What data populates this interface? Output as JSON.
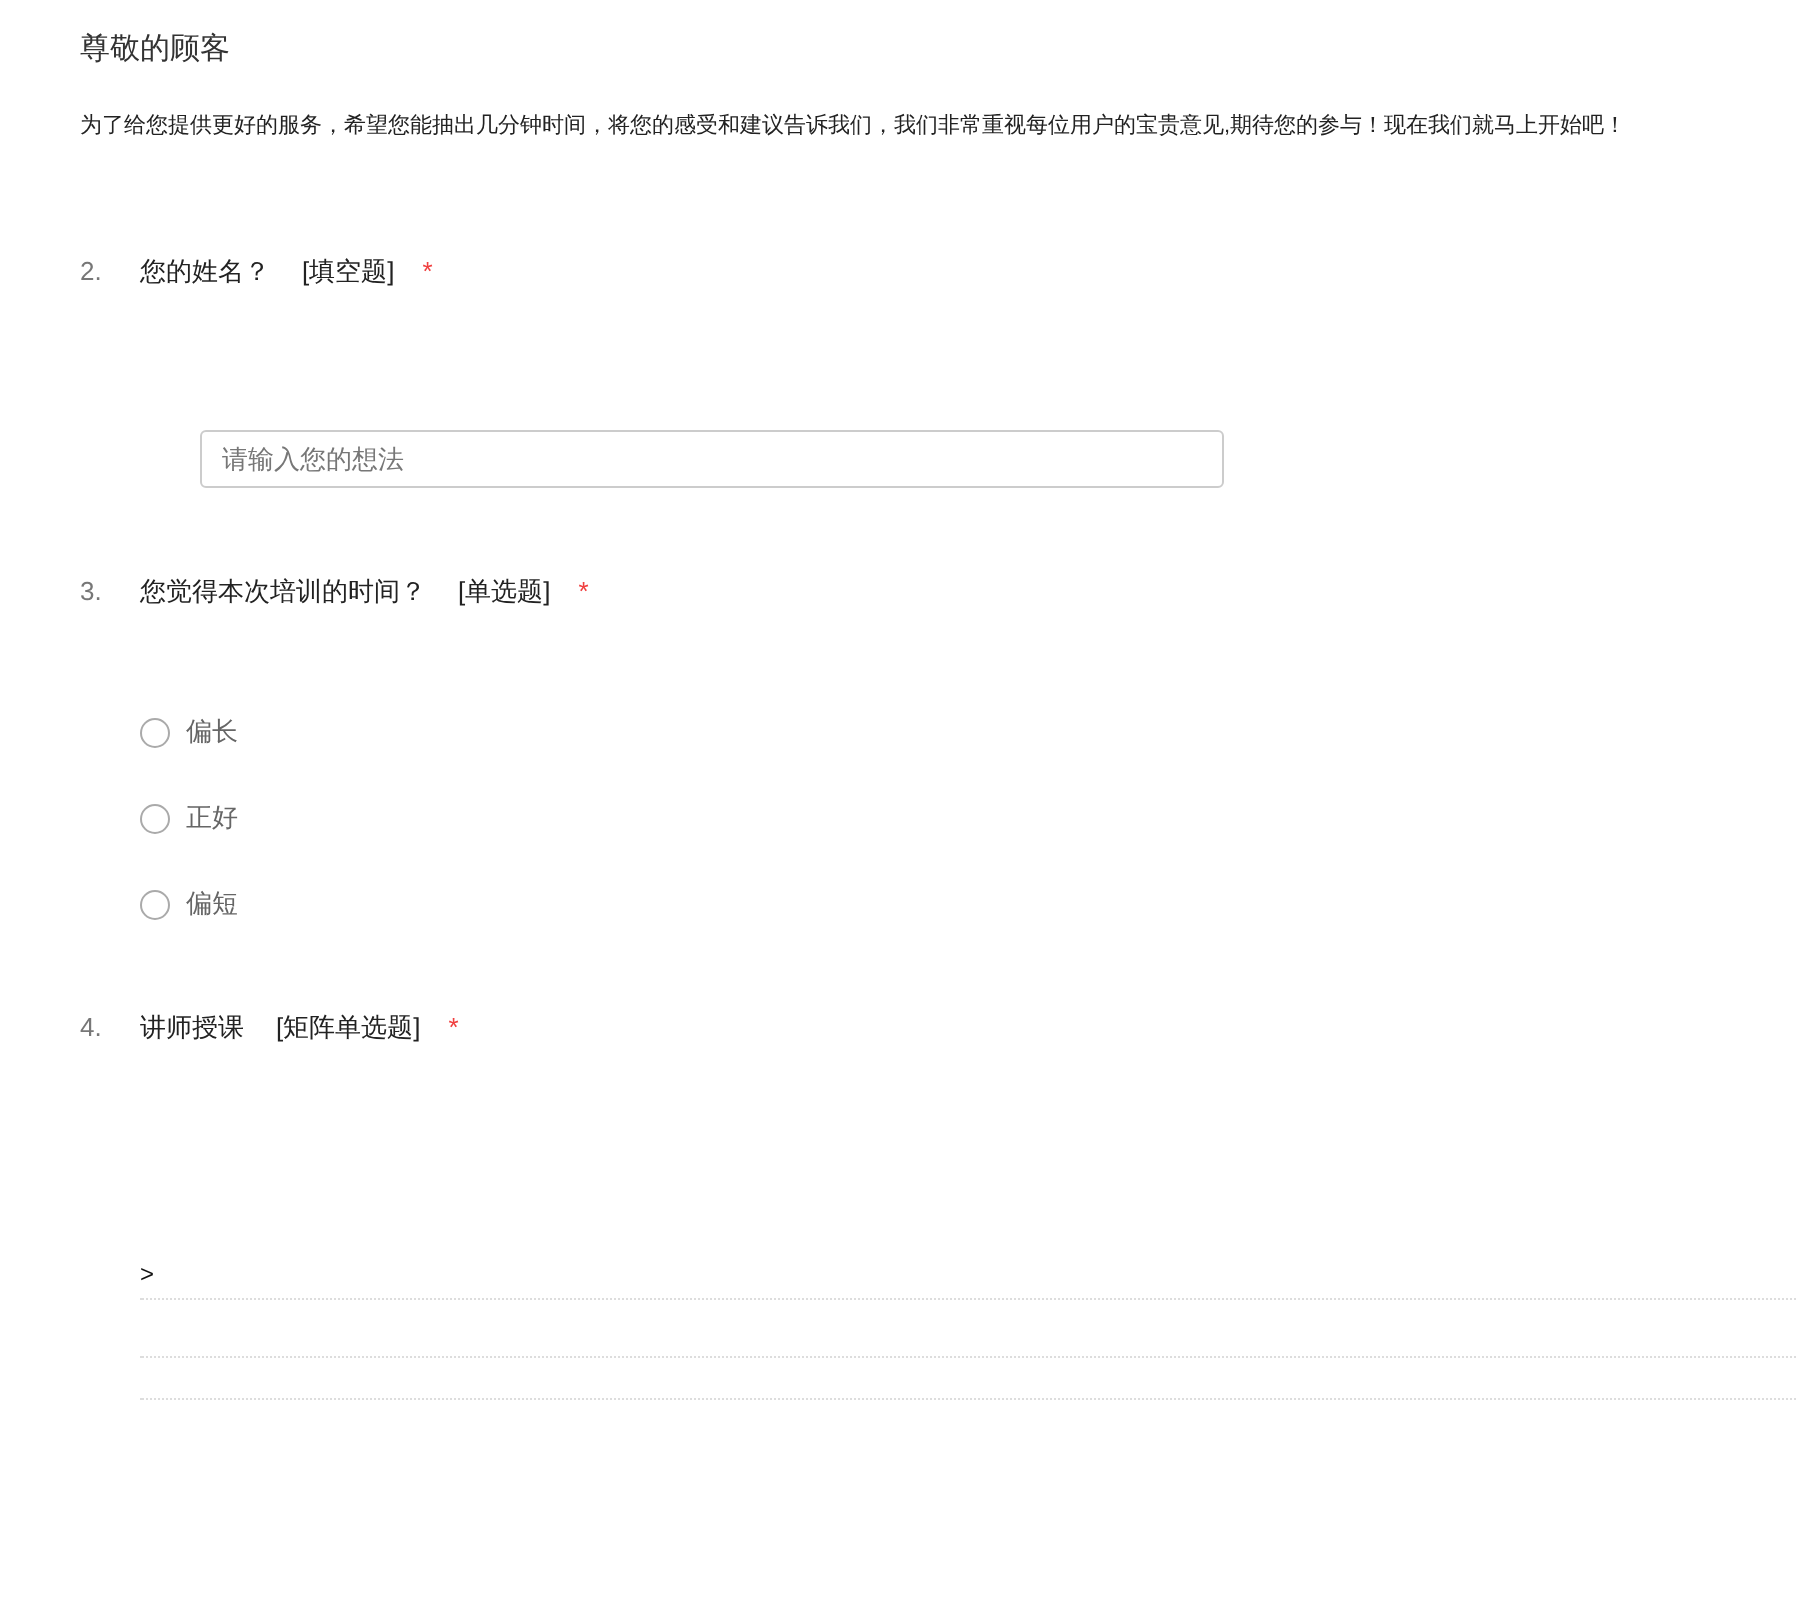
{
  "title": "尊敬的顾客",
  "intro": "为了给您提供更好的服务，希望您能抽出几分钟时间，将您的感受和建议告诉我们，我们非常重视每位用户的宝贵意见,期待您的参与！现在我们就马上开始吧！",
  "questions": [
    {
      "kind": "text",
      "number": "2.",
      "text": "您的姓名？",
      "type_label": "[填空题]",
      "required_mark": "*",
      "placeholder": "请输入您的想法"
    },
    {
      "kind": "radio",
      "number": "3.",
      "text": "您觉得本次培训的时间？",
      "type_label": "[单选题]",
      "required_mark": "*",
      "options": [
        {
          "label": "偏长",
          "selected": false
        },
        {
          "label": "正好",
          "selected": false
        },
        {
          "label": "偏短",
          "selected": false
        }
      ]
    },
    {
      "kind": "matrix",
      "number": "4.",
      "text": "讲师授课",
      "type_label": "[矩阵单选题]",
      "required_mark": "*",
      "row_label": ">"
    }
  ]
}
